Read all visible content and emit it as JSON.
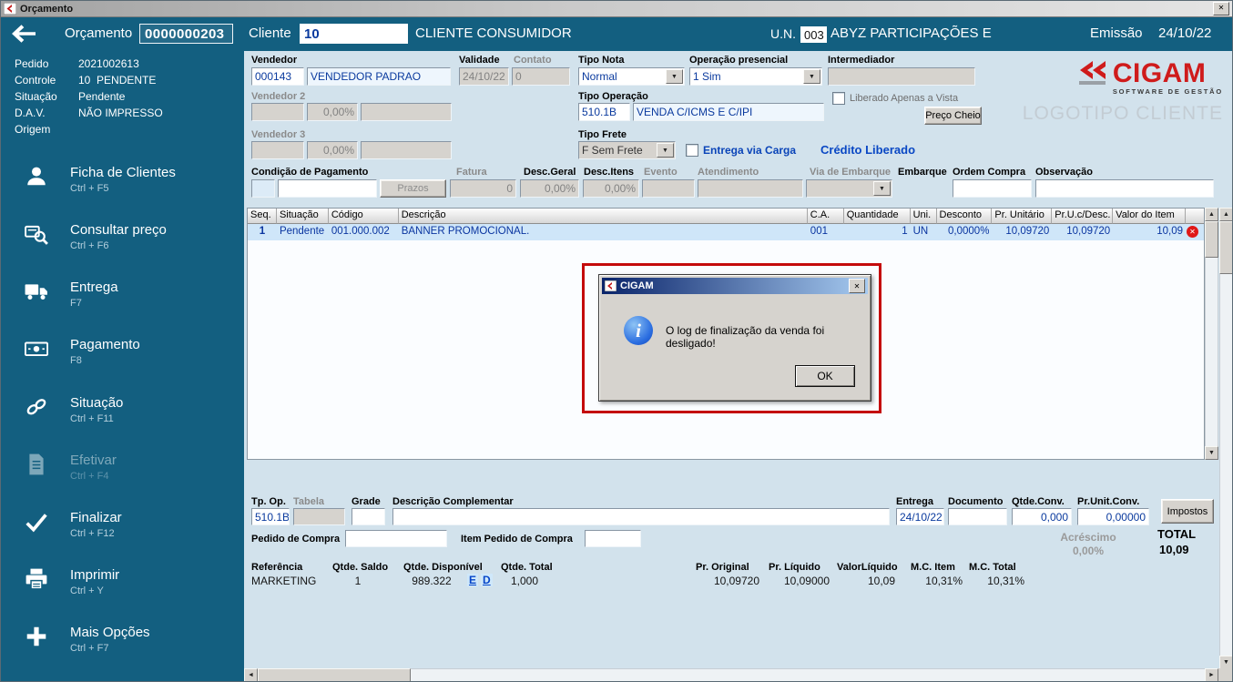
{
  "window": {
    "title": "Orçamento"
  },
  "icons": {
    "close": "✕",
    "combo_arrow": "▼",
    "scroll_up": "▲",
    "scroll_down": "▼",
    "scroll_left": "◄",
    "scroll_right": "►",
    "delete": "✕",
    "info": "i"
  },
  "topbar": {
    "orcamento_label": "Orçamento",
    "orcamento_value": "0000000203",
    "cliente_label": "Cliente",
    "cliente_value": "10",
    "cliente_name": "CLIENTE CONSUMIDOR",
    "un_label": "U.N.",
    "un_value": "003",
    "un_name": "ABYZ PARTICIPAÇÕES E",
    "emissao_label": "Emissão",
    "emissao_value": "24/10/22"
  },
  "sidebar": {
    "info": [
      {
        "label": "Pedido",
        "value": "2021002613"
      },
      {
        "label": "Controle",
        "value": "10  PENDENTE"
      },
      {
        "label": "Situação",
        "value": "Pendente"
      },
      {
        "label": "D.A.V.",
        "value": "NÃO IMPRESSO"
      },
      {
        "label": "Origem",
        "value": ""
      }
    ],
    "menu": [
      {
        "label": "Ficha de Clientes",
        "shortcut": "Ctrl + F5"
      },
      {
        "label": "Consultar preço",
        "shortcut": "Ctrl + F6"
      },
      {
        "label": "Entrega",
        "shortcut": "F7"
      },
      {
        "label": "Pagamento",
        "shortcut": "F8"
      },
      {
        "label": "Situação",
        "shortcut": "Ctrl + F11"
      },
      {
        "label": "Efetivar",
        "shortcut": "Ctrl + F4"
      },
      {
        "label": "Finalizar",
        "shortcut": "Ctrl + F12"
      },
      {
        "label": "Imprimir",
        "shortcut": "Ctrl + Y"
      },
      {
        "label": "Mais Opções",
        "shortcut": "Ctrl + F7"
      }
    ]
  },
  "form": {
    "vendedor": {
      "label": "Vendedor",
      "code": "000143",
      "name": "VENDEDOR PADRAO"
    },
    "validade": {
      "label": "Validade",
      "value": "24/10/22"
    },
    "contato": {
      "label": "Contato",
      "value": "0"
    },
    "tipo_nota": {
      "label": "Tipo Nota",
      "value": "Normal"
    },
    "operacao_presencial": {
      "label": "Operação presencial",
      "value": "1 Sim"
    },
    "intermediador": {
      "label": "Intermediador"
    },
    "vendedor2": {
      "label": "Vendedor 2",
      "pct": "0,00%"
    },
    "vendedor3": {
      "label": "Vendedor 3",
      "pct": "0,00%"
    },
    "tipo_operacao": {
      "label": "Tipo Operação",
      "code": "510.1B",
      "name": "VENDA C/ICMS E C/IPI"
    },
    "liberado_avista_label": "Liberado Apenas a Vista",
    "preco_cheio_label": "Preço Cheio",
    "tipo_frete": {
      "label": "Tipo Frete",
      "value": "F Sem Frete"
    },
    "entrega_via_carga_label": "Entrega via Carga",
    "credito_liberado_label": "Crédito Liberado",
    "condicao_pagamento_label": "Condição de Pagamento",
    "prazos_label": "Prazos",
    "fatura": {
      "label": "Fatura",
      "value": "0"
    },
    "desc_geral": {
      "label": "Desc.Geral",
      "value": "0,00%"
    },
    "desc_itens": {
      "label": "Desc.Itens",
      "value": "0,00%"
    },
    "evento_label": "Evento",
    "atendimento_label": "Atendimento",
    "via_embarque_label": "Via de Embarque",
    "embarque_label": "Embarque",
    "ordem_compra_label": "Ordem Compra",
    "observacao_label": "Observação"
  },
  "items_table": {
    "headers": [
      "Seq.",
      "Situação",
      "Código",
      "Descrição",
      "C.A.",
      "Quantidade",
      "Uni.",
      "Desconto",
      "Pr. Unitário",
      "Pr.U.c/Desc.",
      "Valor do Item"
    ],
    "row": {
      "seq": "1",
      "situacao": "Pendente",
      "codigo": "001.000.002",
      "descricao": "BANNER PROMOCIONAL.",
      "ca": "001",
      "quantidade": "1",
      "uni": "UN",
      "desconto": "0,0000%",
      "pr_unitario": "10,09720",
      "pr_u_c_desc": "10,09720",
      "valor_item": "10,09"
    }
  },
  "dialog": {
    "title": "CIGAM",
    "message": "O log de finalização da venda foi desligado!",
    "ok_label": "OK"
  },
  "details": {
    "tp_op": {
      "label": "Tp. Op.",
      "value": "510.1B"
    },
    "tabela_label": "Tabela",
    "grade_label": "Grade",
    "descricao_complementar_label": "Descrição Complementar",
    "entrega": {
      "label": "Entrega",
      "value": "24/10/22"
    },
    "documento_label": "Documento",
    "qtde_conv": {
      "label": "Qtde.Conv.",
      "value": "0,000"
    },
    "pr_unit_conv": {
      "label": "Pr.Unit.Conv.",
      "value": "0,00000"
    },
    "impostos_label": "Impostos",
    "pedido_compra_label": "Pedido de Compra",
    "item_pedido_compra_label": "Item Pedido de Compra",
    "acrescimo": {
      "label": "Acréscimo",
      "value": "0,00%"
    },
    "total": {
      "label": "TOTAL",
      "value": "10,09"
    }
  },
  "stats": {
    "referencia": {
      "label": "Referência",
      "value": "MARKETING"
    },
    "qtde_saldo": {
      "label": "Qtde. Saldo",
      "value": "1"
    },
    "qtde_disponivel": {
      "label": "Qtde. Disponível",
      "value": "989.322",
      "link_e": "E",
      "link_d": "D"
    },
    "qtde_total": {
      "label": "Qtde. Total",
      "value": "1,000"
    },
    "pr_original": {
      "label": "Pr. Original",
      "value": "10,09720"
    },
    "pr_liquido": {
      "label": "Pr. Líquido",
      "value": "10,09000"
    },
    "valor_liquido": {
      "label": "ValorLíquido",
      "value": "10,09"
    },
    "mc_item": {
      "label": "M.C. Item",
      "value": "10,31%"
    },
    "mc_total": {
      "label": "M.C. Total",
      "value": "10,31%"
    }
  },
  "logo": {
    "brand": "CIGAM",
    "tagline": "SOFTWARE DE GESTÃO",
    "client_placeholder": "LOGOTIPO CLIENTE"
  },
  "colors": {
    "teal": "#135F80",
    "navy": "#0A3A9E",
    "accent_red": "#CF1B1B"
  }
}
